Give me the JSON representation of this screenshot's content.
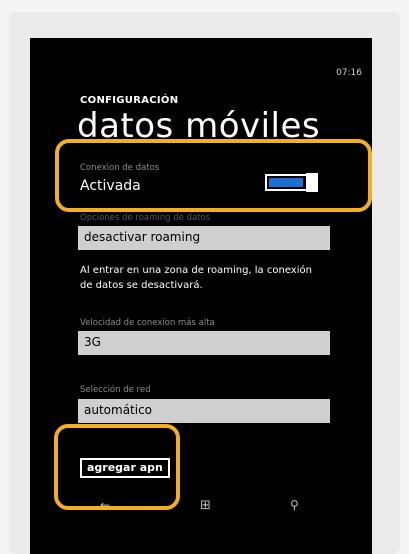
{
  "status_bar": {
    "time": "07:16"
  },
  "header": {
    "app_title": "CONFIGURACIÓN",
    "page_title": "datos móviles"
  },
  "data_connection": {
    "label": "Conexion de datos",
    "value": "Activada",
    "state_on": true
  },
  "roaming": {
    "label": "Opciones de roaming de datos",
    "selected": "desactivar roaming",
    "note": "Al entrar en una zona de roaming, la conexión de datos se desactivará."
  },
  "connection_speed": {
    "label": "Velocidad de conexion más alta",
    "selected": "3G"
  },
  "network": {
    "label": "Selección de red",
    "selected": "automático"
  },
  "apn_button": {
    "label": "agregar apn"
  },
  "app_bar": {
    "back_icon": "back-arrow-icon",
    "home_icon": "windows-logo-icon",
    "search_icon": "search-icon"
  },
  "colors": {
    "accent": "#1a6fd1",
    "highlight": "#f2b01e",
    "field_bg": "#cfcfcf"
  }
}
